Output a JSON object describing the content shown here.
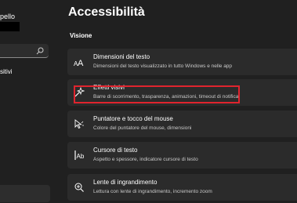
{
  "sidebar": {
    "user_name": "pello",
    "search_placeholder": "",
    "items": [
      {
        "label": "sitivi"
      }
    ]
  },
  "page": {
    "title": "Accessibilità",
    "section": "Visione"
  },
  "cards": [
    {
      "title": "Dimensioni del testo",
      "description": "Dimensioni del testo visualizzato in tutto Windows e nelle app",
      "icon": "text-size-icon"
    },
    {
      "title": "Effetti visivi",
      "description": "Barre di scorrimento, trasparenza, animazioni, timeout di notifica",
      "icon": "sparkle-icon"
    },
    {
      "title": "Puntatore e tocco del mouse",
      "description": "Colore del puntatore del mouse, dimensioni",
      "icon": "pointer-icon"
    },
    {
      "title": "Cursore di testo",
      "description": "Aspetto e spessore, indicatore cursore di testo",
      "icon": "text-cursor-icon"
    },
    {
      "title": "Lente di ingrandimento",
      "description": "Lettura con lente di ingrandimento, incremento zoom",
      "icon": "magnifier-icon"
    }
  ],
  "colors": {
    "background": "#202020",
    "card": "#2b2b2b",
    "highlight": "#e0242e"
  }
}
